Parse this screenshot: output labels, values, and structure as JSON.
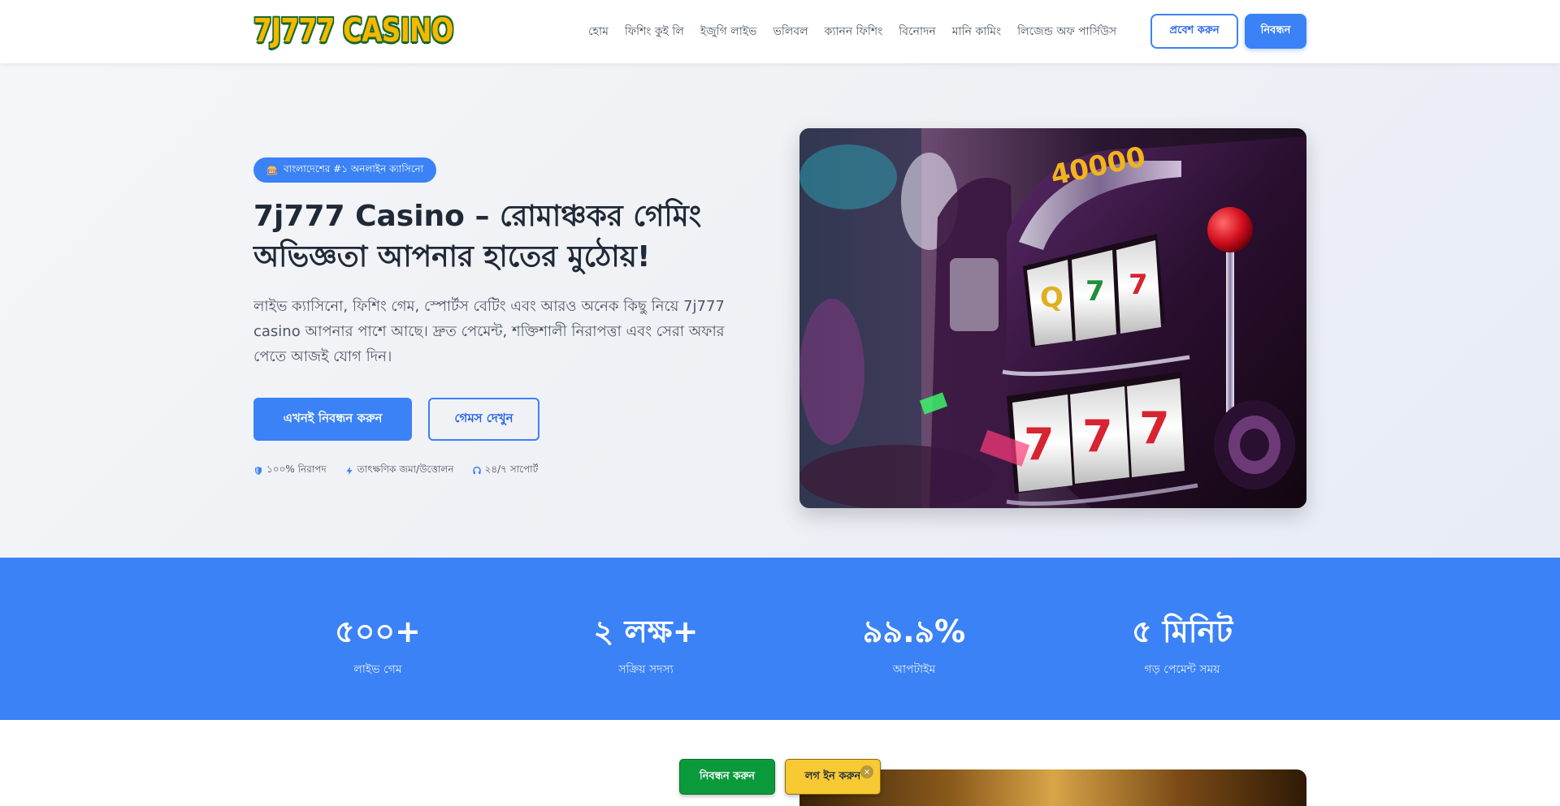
{
  "header": {
    "logo_text": "7J777 CASINO",
    "nav": [
      "হোম",
      "ফিশিং কুই লি",
      "ইজুগি লাইভ",
      "ভলিবল",
      "ক্যানন ফিশিং",
      "বিনোদন",
      "মানি কামিং",
      "লিজেন্ড অফ পার্সিউস"
    ],
    "login_label": "প্রবেশ করুন",
    "register_label": "নিবন্ধন"
  },
  "hero": {
    "badge_icon": "🎰",
    "badge_text": "বাংলাদেশের #১ অনলাইন ক্যাসিনো",
    "title": "7j777 Casino – রোমাঞ্চকর গেমিং অভিজ্ঞতা আপনার হাতের মুঠোয়!",
    "description": "লাইভ ক্যাসিনো, ফিশিং গেম, স্পোর্টস বেটিং এবং আরও অনেক কিছু নিয়ে 7j777 casino আপনার পাশে আছে। দ্রুত পেমেন্ট, শক্তিশালী নিরাপত্তা এবং সেরা অফার পেতে আজই যোগ দিন।",
    "cta_primary": "এখনই নিবন্ধন করুন",
    "cta_secondary": "গেমস দেখুন",
    "features": [
      {
        "icon": "shield-icon",
        "text": "১০০% নিরাপদ"
      },
      {
        "icon": "bolt-icon",
        "text": "তাৎক্ষণিক জমা/উত্তোলন"
      },
      {
        "icon": "headset-icon",
        "text": "২৪/৭ সাপোর্ট"
      }
    ]
  },
  "stats": [
    {
      "value": "৫০০+",
      "label": "লাইভ গেম"
    },
    {
      "value": "২ লক্ষ+",
      "label": "সক্রিয় সদস্য"
    },
    {
      "value": "৯৯.৯%",
      "label": "আপটাইম"
    },
    {
      "value": "৫ মিনিট",
      "label": "গড় পেমেন্ট সময়"
    }
  ],
  "floating": {
    "register_label": "নিবন্ধন করুন",
    "login_label": "লগ ইন করুন",
    "close_symbol": "×"
  },
  "colors": {
    "primary": "#3b82f6",
    "green": "#0a9a3c",
    "yellow": "#f7c932"
  }
}
